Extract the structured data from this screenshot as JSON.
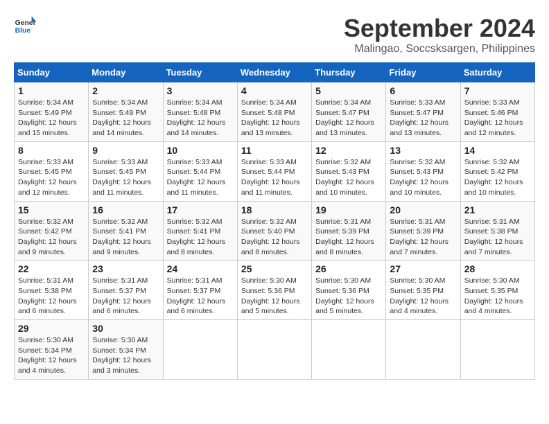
{
  "header": {
    "logo_text_general": "General",
    "logo_text_blue": "Blue",
    "month_title": "September 2024",
    "location": "Malingao, Soccsksargen, Philippines"
  },
  "calendar": {
    "days_of_week": [
      "Sunday",
      "Monday",
      "Tuesday",
      "Wednesday",
      "Thursday",
      "Friday",
      "Saturday"
    ],
    "weeks": [
      [
        {
          "day": "",
          "content": ""
        },
        {
          "day": "2",
          "content": "Sunrise: 5:34 AM\nSunset: 5:49 PM\nDaylight: 12 hours\nand 14 minutes."
        },
        {
          "day": "3",
          "content": "Sunrise: 5:34 AM\nSunset: 5:48 PM\nDaylight: 12 hours\nand 14 minutes."
        },
        {
          "day": "4",
          "content": "Sunrise: 5:34 AM\nSunset: 5:48 PM\nDaylight: 12 hours\nand 13 minutes."
        },
        {
          "day": "5",
          "content": "Sunrise: 5:34 AM\nSunset: 5:47 PM\nDaylight: 12 hours\nand 13 minutes."
        },
        {
          "day": "6",
          "content": "Sunrise: 5:33 AM\nSunset: 5:47 PM\nDaylight: 12 hours\nand 13 minutes."
        },
        {
          "day": "7",
          "content": "Sunrise: 5:33 AM\nSunset: 5:46 PM\nDaylight: 12 hours\nand 12 minutes."
        }
      ],
      [
        {
          "day": "1",
          "content": "Sunrise: 5:34 AM\nSunset: 5:49 PM\nDaylight: 12 hours\nand 15 minutes."
        },
        {
          "day": "9",
          "content": "Sunrise: 5:33 AM\nSunset: 5:45 PM\nDaylight: 12 hours\nand 11 minutes."
        },
        {
          "day": "10",
          "content": "Sunrise: 5:33 AM\nSunset: 5:44 PM\nDaylight: 12 hours\nand 11 minutes."
        },
        {
          "day": "11",
          "content": "Sunrise: 5:33 AM\nSunset: 5:44 PM\nDaylight: 12 hours\nand 11 minutes."
        },
        {
          "day": "12",
          "content": "Sunrise: 5:32 AM\nSunset: 5:43 PM\nDaylight: 12 hours\nand 10 minutes."
        },
        {
          "day": "13",
          "content": "Sunrise: 5:32 AM\nSunset: 5:43 PM\nDaylight: 12 hours\nand 10 minutes."
        },
        {
          "day": "14",
          "content": "Sunrise: 5:32 AM\nSunset: 5:42 PM\nDaylight: 12 hours\nand 10 minutes."
        }
      ],
      [
        {
          "day": "8",
          "content": "Sunrise: 5:33 AM\nSunset: 5:45 PM\nDaylight: 12 hours\nand 12 minutes."
        },
        {
          "day": "16",
          "content": "Sunrise: 5:32 AM\nSunset: 5:41 PM\nDaylight: 12 hours\nand 9 minutes."
        },
        {
          "day": "17",
          "content": "Sunrise: 5:32 AM\nSunset: 5:41 PM\nDaylight: 12 hours\nand 8 minutes."
        },
        {
          "day": "18",
          "content": "Sunrise: 5:32 AM\nSunset: 5:40 PM\nDaylight: 12 hours\nand 8 minutes."
        },
        {
          "day": "19",
          "content": "Sunrise: 5:31 AM\nSunset: 5:39 PM\nDaylight: 12 hours\nand 8 minutes."
        },
        {
          "day": "20",
          "content": "Sunrise: 5:31 AM\nSunset: 5:39 PM\nDaylight: 12 hours\nand 7 minutes."
        },
        {
          "day": "21",
          "content": "Sunrise: 5:31 AM\nSunset: 5:38 PM\nDaylight: 12 hours\nand 7 minutes."
        }
      ],
      [
        {
          "day": "15",
          "content": "Sunrise: 5:32 AM\nSunset: 5:42 PM\nDaylight: 12 hours\nand 9 minutes."
        },
        {
          "day": "23",
          "content": "Sunrise: 5:31 AM\nSunset: 5:37 PM\nDaylight: 12 hours\nand 6 minutes."
        },
        {
          "day": "24",
          "content": "Sunrise: 5:31 AM\nSunset: 5:37 PM\nDaylight: 12 hours\nand 6 minutes."
        },
        {
          "day": "25",
          "content": "Sunrise: 5:30 AM\nSunset: 5:36 PM\nDaylight: 12 hours\nand 5 minutes."
        },
        {
          "day": "26",
          "content": "Sunrise: 5:30 AM\nSunset: 5:36 PM\nDaylight: 12 hours\nand 5 minutes."
        },
        {
          "day": "27",
          "content": "Sunrise: 5:30 AM\nSunset: 5:35 PM\nDaylight: 12 hours\nand 4 minutes."
        },
        {
          "day": "28",
          "content": "Sunrise: 5:30 AM\nSunset: 5:35 PM\nDaylight: 12 hours\nand 4 minutes."
        }
      ],
      [
        {
          "day": "22",
          "content": "Sunrise: 5:31 AM\nSunset: 5:38 PM\nDaylight: 12 hours\nand 6 minutes."
        },
        {
          "day": "30",
          "content": "Sunrise: 5:30 AM\nSunset: 5:34 PM\nDaylight: 12 hours\nand 3 minutes."
        },
        {
          "day": "",
          "content": ""
        },
        {
          "day": "",
          "content": ""
        },
        {
          "day": "",
          "content": ""
        },
        {
          "day": "",
          "content": ""
        },
        {
          "day": "",
          "content": ""
        }
      ],
      [
        {
          "day": "29",
          "content": "Sunrise: 5:30 AM\nSunset: 5:34 PM\nDaylight: 12 hours\nand 4 minutes."
        },
        {
          "day": "",
          "content": ""
        },
        {
          "day": "",
          "content": ""
        },
        {
          "day": "",
          "content": ""
        },
        {
          "day": "",
          "content": ""
        },
        {
          "day": "",
          "content": ""
        },
        {
          "day": "",
          "content": ""
        }
      ]
    ]
  }
}
